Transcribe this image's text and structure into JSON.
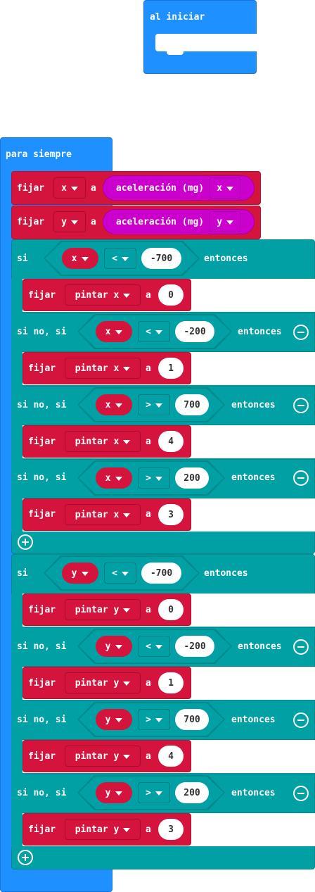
{
  "on_start": {
    "label": "al iniciar"
  },
  "forever": {
    "label": "para siempre"
  },
  "set_x": {
    "set": "fijar",
    "var": "x",
    "to": "a",
    "sensor": "aceleración (mg)",
    "axis": "x"
  },
  "set_y": {
    "set": "fijar",
    "var": "y",
    "to": "a",
    "sensor": "aceleración (mg)",
    "axis": "y"
  },
  "if_x": {
    "kw_if": "si",
    "kw_elif": "si no, si",
    "kw_then": "entonces",
    "branches": [
      {
        "var": "x",
        "op": "<",
        "value": "-700",
        "set": "fijar",
        "target": "pintar x",
        "to": "a",
        "result": "0"
      },
      {
        "var": "x",
        "op": "<",
        "value": "-200",
        "set": "fijar",
        "target": "pintar x",
        "to": "a",
        "result": "1"
      },
      {
        "var": "x",
        "op": ">",
        "value": "700",
        "set": "fijar",
        "target": "pintar x",
        "to": "a",
        "result": "4"
      },
      {
        "var": "x",
        "op": ">",
        "value": "200",
        "set": "fijar",
        "target": "pintar x",
        "to": "a",
        "result": "3"
      }
    ]
  },
  "if_y": {
    "kw_if": "si",
    "kw_elif": "si no, si",
    "kw_then": "entonces",
    "branches": [
      {
        "var": "y",
        "op": "<",
        "value": "-700",
        "set": "fijar",
        "target": "pintar y",
        "to": "a",
        "result": "0"
      },
      {
        "var": "y",
        "op": "<",
        "value": "-200",
        "set": "fijar",
        "target": "pintar y",
        "to": "a",
        "result": "1"
      },
      {
        "var": "y",
        "op": ">",
        "value": "700",
        "set": "fijar",
        "target": "pintar y",
        "to": "a",
        "result": "4"
      },
      {
        "var": "y",
        "op": ">",
        "value": "200",
        "set": "fijar",
        "target": "pintar y",
        "to": "a",
        "result": "3"
      }
    ]
  },
  "colors": {
    "event": "#1e90ff",
    "variable": "#d4143c",
    "logic": "#00a0a4",
    "input": "#cc00cc"
  },
  "icons": {
    "add": "plus-circle-icon",
    "remove": "minus-circle-icon",
    "dropdown": "caret-down-icon"
  }
}
